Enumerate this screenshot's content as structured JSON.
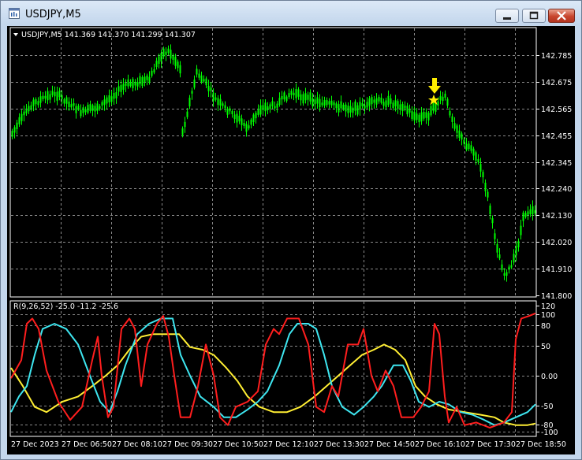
{
  "window": {
    "title": "USDJPY,M5"
  },
  "price_panel": {
    "header": "USDJPY,M5  141.369 141.370 141.299 141.307",
    "price_labels": [
      "142.785",
      "142.675",
      "142.565",
      "142.455",
      "142.345",
      "142.240",
      "142.130",
      "142.020",
      "141.910",
      "141.800"
    ]
  },
  "oscillator_panel": {
    "header": "R(9,26,52) -25.0 -11.2 -25.6",
    "axis_labels": [
      "120",
      "100",
      "80",
      "50",
      "0.00",
      "-50",
      "-80",
      "-100"
    ]
  },
  "time_labels": [
    "27 Dec 2023",
    "27 Dec 06:50",
    "27 Dec 08:10",
    "27 Dec 09:30",
    "27 Dec 10:50",
    "27 Dec 12:10",
    "27 Dec 13:30",
    "27 Dec 14:50",
    "27 Dec 16:10",
    "27 Dec 17:30",
    "27 Dec 18:50"
  ],
  "colors": {
    "background": "#000000",
    "grid": "#8a8a8a",
    "candles": "#00ff00",
    "series_red": "#ff1e1e",
    "series_cyan": "#3ee6f0",
    "series_yellow": "#ffee33",
    "arrow": "#ffee00"
  },
  "markers": {
    "arrow_icon": "down-arrow-icon",
    "star_icon": "star-icon"
  },
  "chart_data": [
    {
      "type": "line",
      "description_source": "candlestick price chart",
      "y_axis_ticks": [
        142.785,
        142.675,
        142.565,
        142.455,
        142.345,
        142.24,
        142.13,
        142.02,
        141.91,
        141.8
      ],
      "ylim": [
        141.8,
        142.82
      ],
      "x_ticks": [
        "27 Dec 2023",
        "27 Dec 06:50",
        "27 Dec 08:10",
        "27 Dec 09:30",
        "27 Dec 10:50",
        "27 Dec 12:10",
        "27 Dec 13:30",
        "27 Dec 14:50",
        "27 Dec 16:10",
        "27 Dec 17:30",
        "27 Dec 18:50"
      ],
      "close_points": [
        [
          "27 Dec 2023",
          142.5
        ],
        [
          "27 Dec 06:50",
          142.62
        ],
        [
          "27 Dec 08:10",
          142.66
        ],
        [
          "27 Dec 09:30",
          142.8
        ],
        [
          "27 Dec 10:50",
          142.55
        ],
        [
          "27 Dec 12:10",
          142.62
        ],
        [
          "27 Dec 13:30",
          142.58
        ],
        [
          "27 Dec 14:50",
          142.56
        ],
        [
          "27 Dec 16:10",
          142.58
        ],
        [
          "27 Dec 17:30",
          142.3
        ],
        [
          "27 Dec 18:50",
          142.14
        ]
      ],
      "grid": true
    },
    {
      "type": "line",
      "ylim": [
        -100,
        120
      ],
      "y_ticks": [
        120,
        100,
        80,
        50,
        0,
        -50,
        -80,
        -100
      ],
      "x_ticks": [
        "27 Dec 2023",
        "27 Dec 06:50",
        "27 Dec 08:10",
        "27 Dec 09:30",
        "27 Dec 10:50",
        "27 Dec 12:10",
        "27 Dec 13:30",
        "27 Dec 14:50",
        "27 Dec 16:10",
        "27 Dec 17:30",
        "27 Dec 18:50"
      ],
      "series": [
        {
          "name": "R(9)",
          "values": [
            -10,
            100,
            -60,
            70,
            100,
            -80,
            20,
            -95,
            -80,
            -100,
            100
          ]
        },
        {
          "name": "R(26)",
          "values": [
            -40,
            95,
            -50,
            90,
            -10,
            -80,
            95,
            -60,
            -20,
            -90,
            -60
          ]
        },
        {
          "name": "R(52)",
          "values": [
            10,
            -70,
            80,
            80,
            -30,
            -70,
            0,
            50,
            -60,
            -90,
            -95
          ]
        }
      ],
      "grid": true
    }
  ]
}
